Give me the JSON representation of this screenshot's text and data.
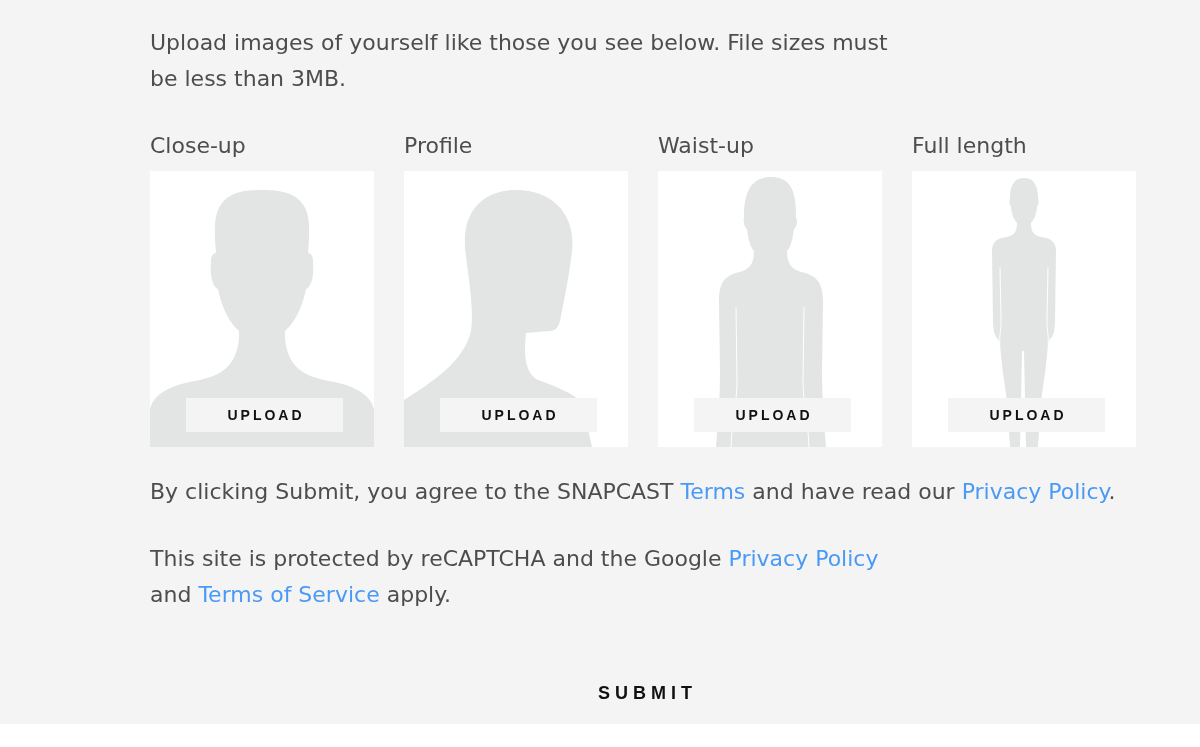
{
  "intro": "Upload images of yourself like those you see below. File sizes must be less than 3MB.",
  "slots": [
    {
      "label": "Close-up",
      "kind": "close-up",
      "upload_button": "UPLOAD"
    },
    {
      "label": "Profile",
      "kind": "profile",
      "upload_button": "UPLOAD"
    },
    {
      "label": "Waist-up",
      "kind": "waist-up",
      "upload_button": "UPLOAD"
    },
    {
      "label": "Full length",
      "kind": "full-length",
      "upload_button": "UPLOAD"
    }
  ],
  "consent": [
    {
      "kind": "text",
      "text": "By clicking Submit, you agree to the SNAPCAST "
    },
    {
      "kind": "link",
      "text": "Terms"
    },
    {
      "kind": "text",
      "text": " and have read our "
    },
    {
      "kind": "link",
      "text": "Privacy Policy"
    },
    {
      "kind": "text",
      "text": "."
    }
  ],
  "recaptcha": [
    {
      "kind": "text",
      "text": "This site is protected by reCAPTCHA and the Google "
    },
    {
      "kind": "link",
      "text": "Privacy Policy"
    },
    {
      "kind": "text",
      "text": " and "
    },
    {
      "kind": "link",
      "text": "Terms of Service"
    },
    {
      "kind": "text",
      "text": " apply."
    }
  ],
  "submit": "SUBMIT"
}
